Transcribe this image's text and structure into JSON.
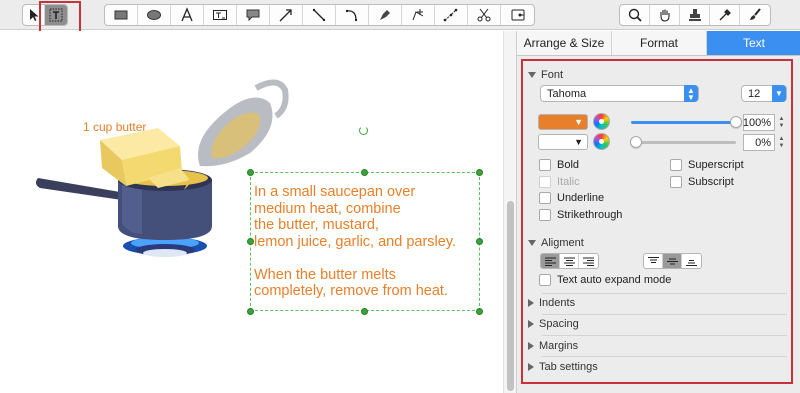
{
  "toolbar": {
    "left_tools": [
      {
        "name": "pointer-tool",
        "icon": "arrow-pointer-icon"
      },
      {
        "name": "text-box-tool",
        "icon": "text-box-icon",
        "selected": true
      }
    ],
    "shape_tools": [
      "rectangle-icon",
      "ellipse-icon",
      "text-icon",
      "text-frame-icon",
      "callout-icon",
      "arrow-line-icon",
      "line-icon",
      "arc-icon",
      "pen-icon",
      "polyline-icon",
      "bezier-icon",
      "scissors-icon",
      "insert-icon"
    ],
    "right_tools": [
      "zoom-icon",
      "hand-icon",
      "stamp-icon",
      "eyedropper-icon",
      "brush-icon"
    ]
  },
  "canvas": {
    "butter_label": "1 cup butter",
    "text_box": "In a small saucepan over\nmedium heat, combine\nthe butter, mustard,\nlemon juice, garlic, and parsley.\n\nWhen the butter melts\ncompletely, remove from heat."
  },
  "inspector": {
    "tabs": [
      {
        "label": "Arrange & Size",
        "active": false
      },
      {
        "label": "Format",
        "active": false
      },
      {
        "label": "Text",
        "active": true
      }
    ],
    "font": {
      "section": "Font",
      "family": "Tahoma",
      "size": "12",
      "text_color": "#e8802b",
      "text_opacity": "100%",
      "bg_opacity": "0%",
      "text_opacity_level": 1.0,
      "bg_opacity_level": 0.0,
      "styles_left": [
        {
          "label": "Bold",
          "disabled": false
        },
        {
          "label": "Italic",
          "disabled": true
        },
        {
          "label": "Underline",
          "disabled": false
        },
        {
          "label": "Strikethrough",
          "disabled": false
        }
      ],
      "styles_right": [
        {
          "label": "Superscript"
        },
        {
          "label": "Subscript"
        }
      ]
    },
    "alignment": {
      "section": "Aligment",
      "auto_expand_label": "Text auto expand mode"
    },
    "collapsed_sections": [
      "Indents",
      "Spacing",
      "Margins",
      "Tab settings"
    ]
  },
  "colors": {
    "accent": "#3b8ff0",
    "highlight_border": "#c8333a",
    "text_orange": "#e8802b",
    "handle_green": "#39a539"
  }
}
